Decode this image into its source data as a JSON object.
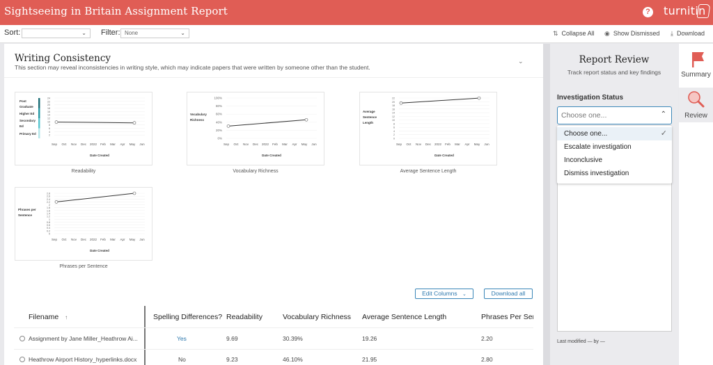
{
  "header": {
    "title": "Sightseeing in Britain Assignment Report",
    "help_icon": "help-circle-icon",
    "logo_text": "turnitin"
  },
  "toolbar": {
    "sort_label": "Sort:",
    "sort_value": "",
    "filter_label": "Filter:",
    "filter_value": "None",
    "collapse_all": "Collapse All",
    "show_dismissed": "Show Dismissed",
    "download": "Download"
  },
  "section": {
    "title": "Writing Consistency",
    "description": "This section may reveal inconsistencies in writing style, which may indicate papers that were written by someone other than the student."
  },
  "chart_data": [
    {
      "type": "line",
      "title": "Readability",
      "ylabel_bands": [
        "Post Graduate",
        "Higher Ed",
        "Secondary Ed",
        "Primary Ed"
      ],
      "xlabel": "Date Created",
      "x": [
        "Sep",
        "Oct",
        "Nov",
        "Dec",
        "2022",
        "Feb",
        "Mar",
        "Apr",
        "May",
        "Jun"
      ],
      "ylim": [
        0,
        24
      ],
      "yticks": [
        2,
        4,
        6,
        8,
        10,
        12,
        14,
        16,
        18,
        20,
        22,
        24
      ],
      "points": [
        {
          "x": "Sep",
          "y": 9.69
        },
        {
          "x": "May",
          "y": 9.23
        }
      ]
    },
    {
      "type": "line",
      "title": "Vocabulary Richness",
      "ylabel": "Vocabulary Richness",
      "xlabel": "Date Created",
      "x": [
        "Sep",
        "Oct",
        "Nov",
        "Dec",
        "2022",
        "Feb",
        "Mar",
        "Apr",
        "May",
        "Jun"
      ],
      "ylim": [
        0,
        100
      ],
      "yticks": [
        "0%",
        "20%",
        "40%",
        "60%",
        "80%",
        "100%"
      ],
      "points": [
        {
          "x": "Sep",
          "y": 30.39
        },
        {
          "x": "May",
          "y": 46.1
        }
      ]
    },
    {
      "type": "line",
      "title": "Average Sentence Length",
      "ylabel": "Average Sentence Length",
      "xlabel": "Date Created",
      "x": [
        "Sep",
        "Oct",
        "Nov",
        "Dec",
        "2022",
        "Feb",
        "Mar",
        "Apr",
        "May",
        "Jun"
      ],
      "ylim": [
        0,
        22
      ],
      "yticks": [
        0,
        2,
        4,
        6,
        8,
        10,
        12,
        14,
        16,
        18,
        20,
        22
      ],
      "points": [
        {
          "x": "Sep",
          "y": 19.26
        },
        {
          "x": "May",
          "y": 21.95
        }
      ]
    },
    {
      "type": "line",
      "title": "Phrases per Sentence",
      "ylabel": "Phrases per Sentence",
      "xlabel": "Date Created",
      "x": [
        "Sep",
        "Oct",
        "Nov",
        "Dec",
        "2022",
        "Feb",
        "Mar",
        "Apr",
        "May",
        "Jun"
      ],
      "ylim": [
        0,
        2.8
      ],
      "yticks": [
        0,
        0.2,
        0.4,
        0.6,
        0.8,
        1.0,
        1.2,
        1.4,
        1.6,
        1.8,
        2.0,
        2.2,
        2.4,
        2.6,
        2.8
      ],
      "points": [
        {
          "x": "Sep",
          "y": 2.2
        },
        {
          "x": "May",
          "y": 2.8
        }
      ]
    }
  ],
  "actions": {
    "edit_columns": "Edit Columns",
    "download_all": "Download all"
  },
  "table": {
    "columns": [
      "Filename",
      "Spelling Differences?",
      "Readability",
      "Vocabulary Richness",
      "Average Sentence Length",
      "Phrases Per Sent"
    ],
    "rows": [
      {
        "filename": "Assignment by Jane Miller_Heathrow Ai...",
        "spelling": "Yes",
        "readability": "9.69",
        "vocab": "30.39%",
        "avg_len": "19.26",
        "phrases": "2.20"
      },
      {
        "filename": "Heathrow Airport History_hyperlinks.docx",
        "spelling": "No",
        "readability": "9.23",
        "vocab": "46.10%",
        "avg_len": "21.95",
        "phrases": "2.80"
      }
    ]
  },
  "review": {
    "title": "Report Review",
    "subtitle": "Track report status and key findings",
    "status_label": "Investigation Status",
    "status_value": "Choose one...",
    "options": [
      "Choose one...",
      "Escalate investigation",
      "Inconclusive",
      "Dismiss investigation"
    ],
    "selected_option": 0,
    "last_modified": "Last modified — by —"
  },
  "rail": {
    "summary": "Summary",
    "review": "Review"
  },
  "colors": {
    "brand": "#e05d55",
    "accent": "#2d78ad"
  }
}
